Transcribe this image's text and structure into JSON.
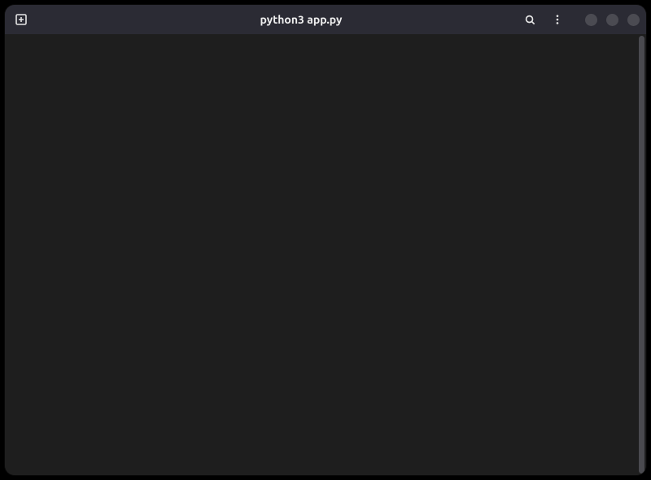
{
  "window": {
    "title": "python3 app.py"
  },
  "titlebar": {
    "new_tab_label": "New Tab",
    "search_label": "Search",
    "menu_label": "Menu",
    "minimize_label": "Minimize",
    "maximize_label": "Maximize",
    "close_label": "Close"
  },
  "terminal": {
    "content": ""
  }
}
